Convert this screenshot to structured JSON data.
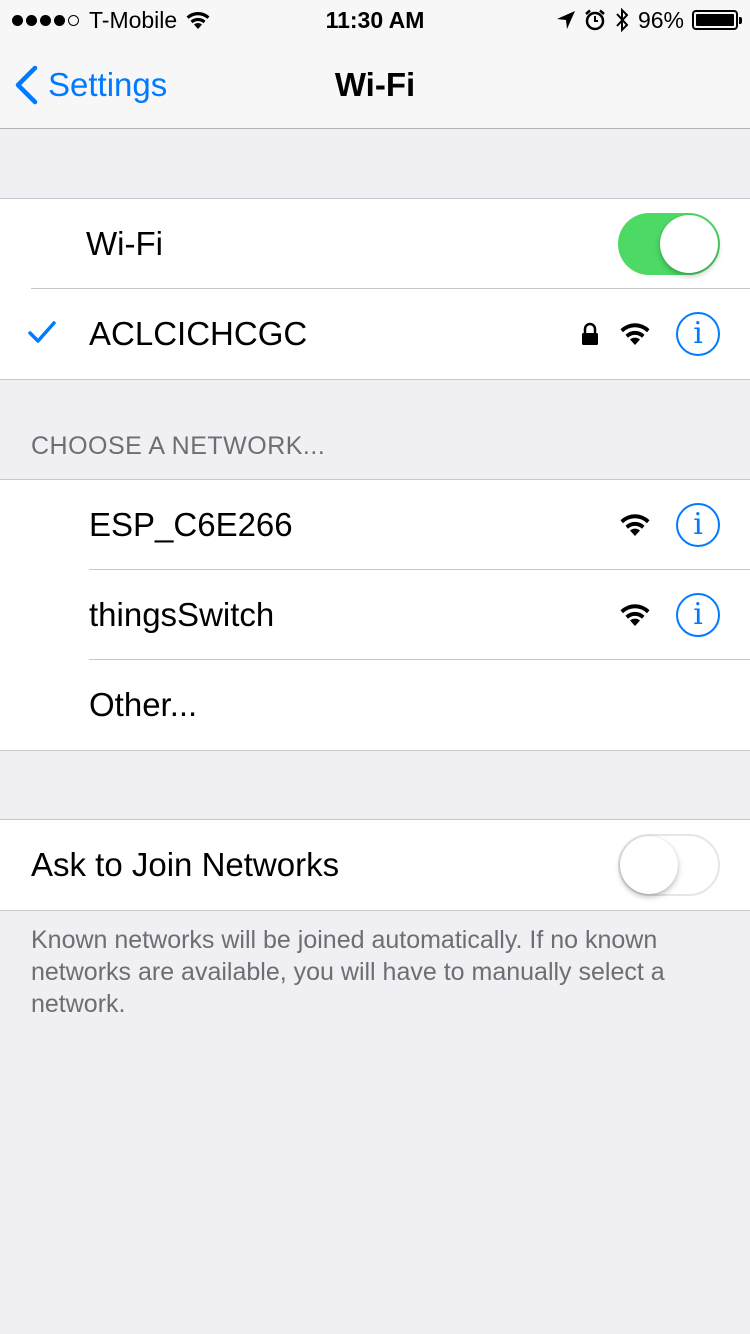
{
  "status_bar": {
    "carrier": "T-Mobile",
    "time": "11:30 AM",
    "battery": "96%",
    "signal_bars_filled": 4,
    "signal_bars_total": 5,
    "icons": [
      "wifi-icon",
      "location-arrow-icon",
      "alarm-icon",
      "bluetooth-icon",
      "battery-icon"
    ]
  },
  "nav": {
    "back_label": "Settings",
    "title": "Wi-Fi"
  },
  "wifi_group": {
    "toggle_label": "Wi-Fi",
    "toggle_on": true,
    "connected_network": "ACLCICHCGC",
    "connected_secured": true
  },
  "choose_section": {
    "header": "CHOOSE A NETWORK...",
    "networks": [
      {
        "name": "ESP_C6E266"
      },
      {
        "name": "thingsSwitch"
      }
    ],
    "other_label": "Other..."
  },
  "ask_group": {
    "label": "Ask to Join Networks",
    "toggle_on": false,
    "footer": "Known networks will be joined automatically. If no known networks are available, you will have to manually select a network."
  },
  "colors": {
    "accent": "#007aff",
    "toggle_on": "#4cd964",
    "background": "#efeff4"
  }
}
